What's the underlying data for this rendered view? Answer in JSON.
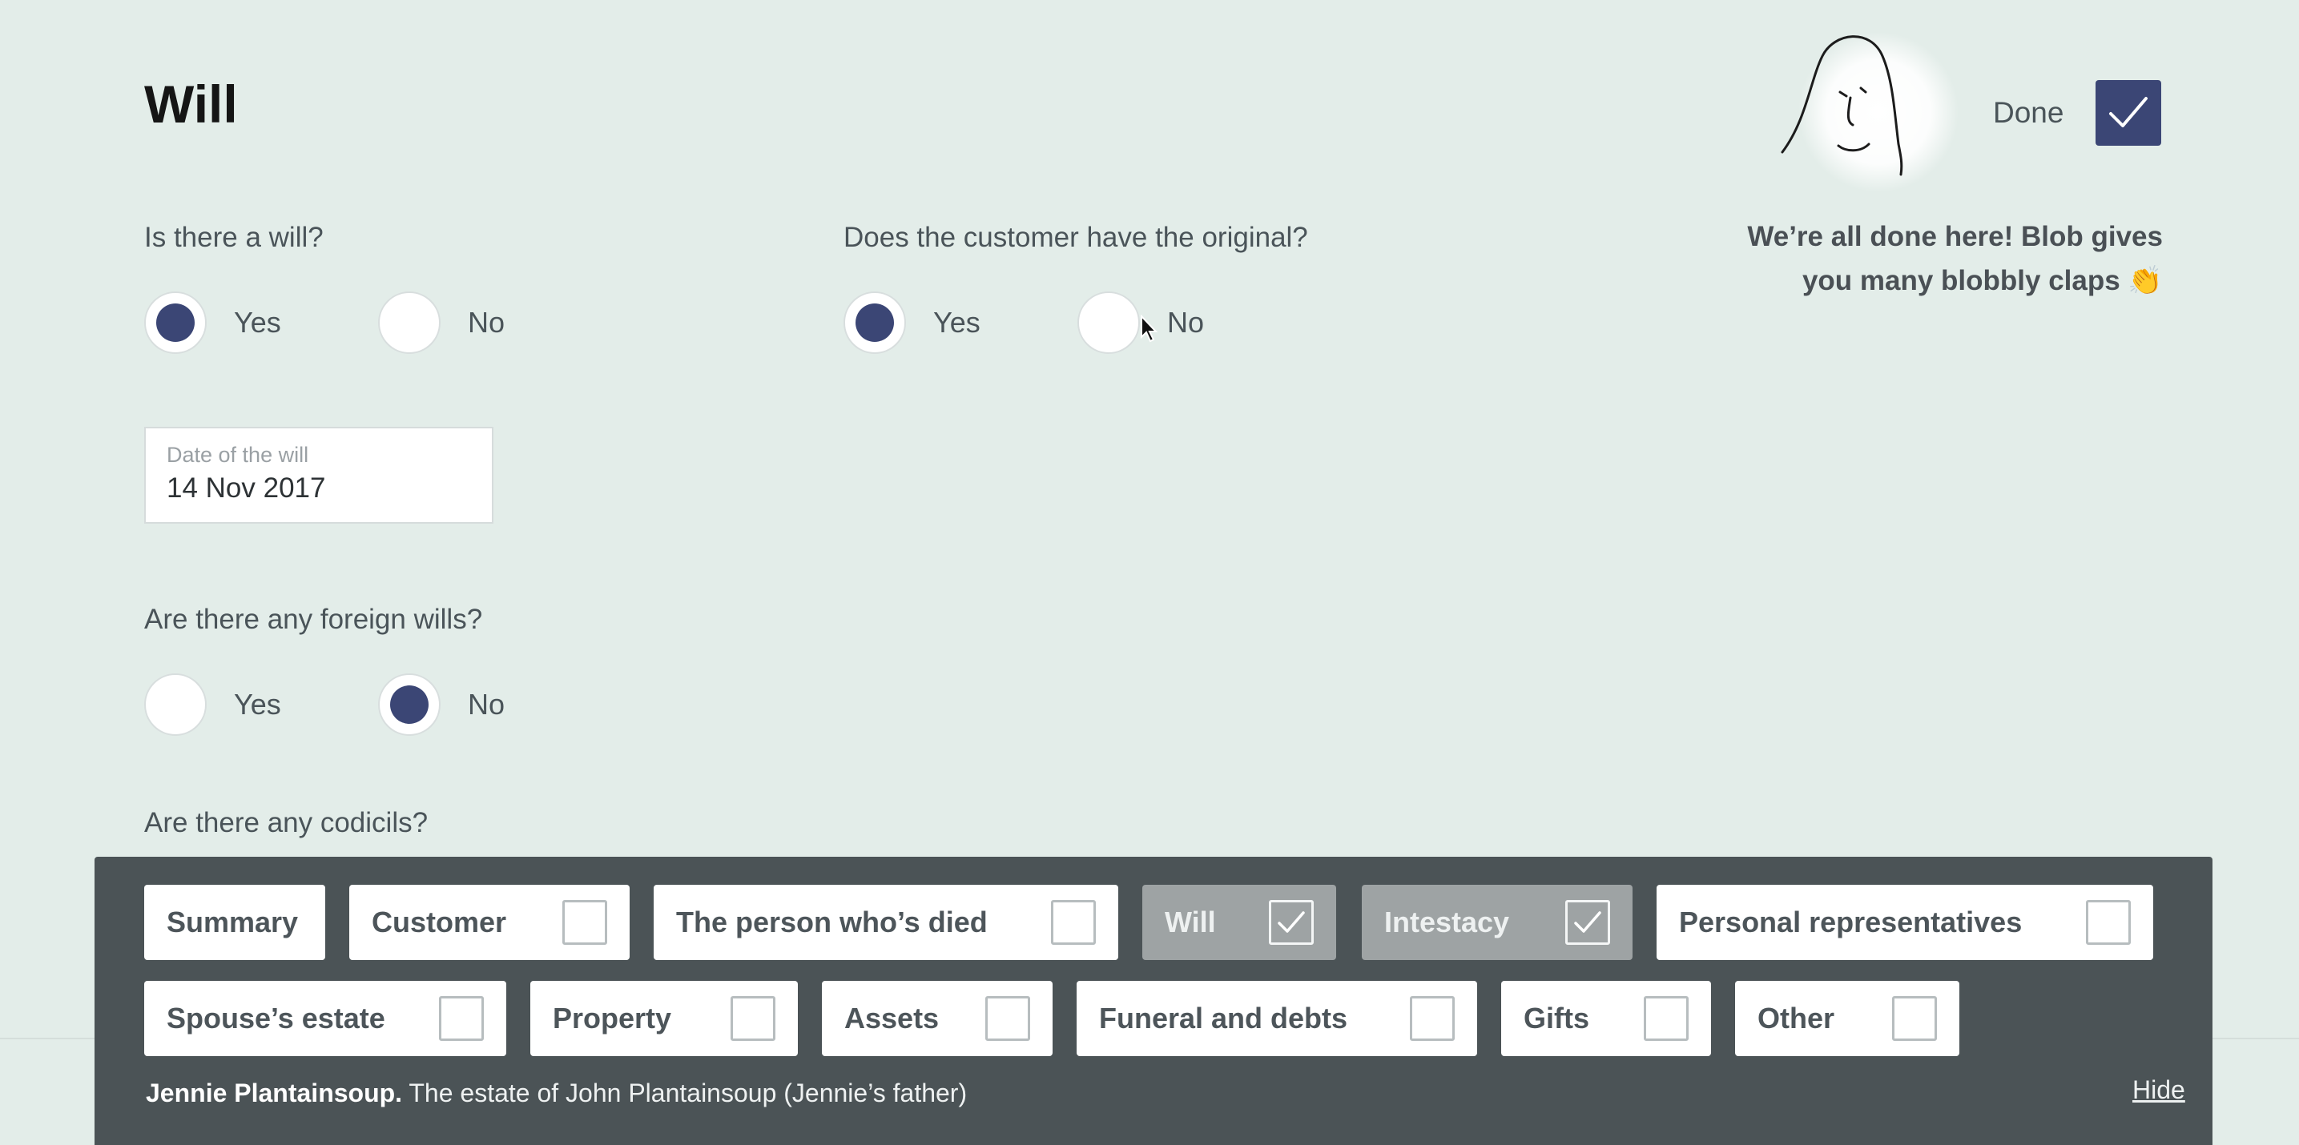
{
  "page": {
    "title": "Will"
  },
  "questions": {
    "is_there_will": {
      "text": "Is there a will?",
      "yes": "Yes",
      "no": "No",
      "selected": "Yes"
    },
    "has_original": {
      "text": "Does the customer have the original?",
      "yes": "Yes",
      "no": "No",
      "selected": "Yes"
    },
    "foreign_wills": {
      "text": "Are there any foreign wills?",
      "yes": "Yes",
      "no": "No",
      "selected": "No"
    },
    "codicils": {
      "text": "Are there any codicils?"
    }
  },
  "date_field": {
    "label": "Date of the will",
    "value": "14 Nov 2017"
  },
  "status": {
    "done_label": "Done",
    "done_checked": true,
    "message_line1": "We’re all done here! Blob gives",
    "message_line2": "you many blobbly claps 👏"
  },
  "nav": {
    "row1": [
      {
        "label": "Summary",
        "checkbox": false,
        "checked": false,
        "done": false
      },
      {
        "label": "Customer",
        "checkbox": true,
        "checked": false,
        "done": false
      },
      {
        "label": "The person who’s died",
        "checkbox": true,
        "checked": false,
        "done": false
      },
      {
        "label": "Will",
        "checkbox": true,
        "checked": true,
        "done": true
      },
      {
        "label": "Intestacy",
        "checkbox": true,
        "checked": true,
        "done": true
      },
      {
        "label": "Personal representatives",
        "checkbox": true,
        "checked": false,
        "done": false
      }
    ],
    "row2": [
      {
        "label": "Spouse’s estate",
        "checkbox": true,
        "checked": false,
        "done": false
      },
      {
        "label": "Property",
        "checkbox": true,
        "checked": false,
        "done": false
      },
      {
        "label": "Assets",
        "checkbox": true,
        "checked": false,
        "done": false
      },
      {
        "label": "Funeral and debts",
        "checkbox": true,
        "checked": false,
        "done": false
      },
      {
        "label": "Gifts",
        "checkbox": true,
        "checked": false,
        "done": false
      },
      {
        "label": "Other",
        "checkbox": true,
        "checked": false,
        "done": false
      }
    ]
  },
  "footer": {
    "customer_name": "Jennie Plantainsoup.",
    "estate_text": " The estate of John Plantainsoup (Jennie’s father)",
    "hide_label": "Hide"
  },
  "colors": {
    "background": "#e3ede9",
    "accent": "#3b4675",
    "panel": "#4b5356"
  },
  "icons": {
    "avatar": "blob-face-icon",
    "done": "check-icon",
    "cursor": "mouse-pointer-icon"
  }
}
